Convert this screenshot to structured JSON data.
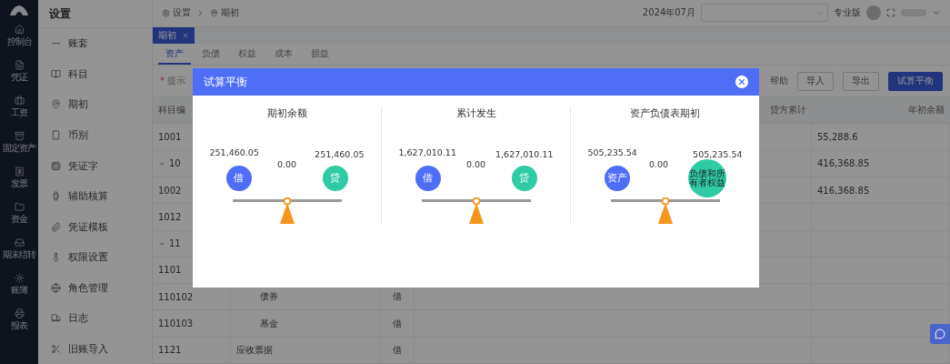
{
  "nav": {
    "items": [
      {
        "label": "控制台"
      },
      {
        "label": "凭证"
      },
      {
        "label": "工资"
      },
      {
        "label": "固定资产"
      },
      {
        "label": "发票"
      },
      {
        "label": "资金"
      },
      {
        "label": "期末结转"
      },
      {
        "label": "账簿"
      },
      {
        "label": "报表"
      }
    ]
  },
  "settings_menu": {
    "title": "设置",
    "items": [
      {
        "label": "账套"
      },
      {
        "label": "科目"
      },
      {
        "label": "期初"
      },
      {
        "label": "币别"
      },
      {
        "label": "凭证字"
      },
      {
        "label": "辅助核算"
      },
      {
        "label": "凭证模板"
      },
      {
        "label": "权限设置"
      },
      {
        "label": "角色管理"
      },
      {
        "label": "日志"
      },
      {
        "label": "旧账导入"
      }
    ]
  },
  "breadcrumb": [
    "设置",
    "期初"
  ],
  "header": {
    "period": "2024年07月",
    "edition": "专业版"
  },
  "page_tabs": [
    {
      "label": "期初",
      "selected": true
    }
  ],
  "category_tabs": [
    {
      "label": "资产",
      "selected": true
    },
    {
      "label": "负债",
      "selected": false
    },
    {
      "label": "权益",
      "selected": false
    },
    {
      "label": "成本",
      "selected": false
    },
    {
      "label": "损益",
      "selected": false
    }
  ],
  "toolbar": {
    "hint_mark": "*",
    "hint": "提示",
    "help": "帮助",
    "buttons": [
      {
        "label": "导入",
        "kind": "default"
      },
      {
        "label": "导出",
        "kind": "default"
      },
      {
        "label": "试算平衡",
        "kind": "primary"
      }
    ]
  },
  "table": {
    "columns": [
      "科目编",
      "贷方累计",
      "年初余额"
    ],
    "rows": [
      {
        "code": "1001",
        "opening": "55,288.6"
      },
      {
        "code": "10",
        "expanded": true,
        "opening": "416,368.85"
      },
      {
        "code": "1002",
        "opening": "416,368.85"
      },
      {
        "code": "1012"
      },
      {
        "code": "11",
        "expanded": true
      },
      {
        "code": "1101"
      },
      {
        "code": "110102",
        "name": "债券",
        "direction": "借"
      },
      {
        "code": "110103",
        "name": "基金",
        "direction": "借"
      },
      {
        "code": "1121",
        "name": "应收票据",
        "direction": "借"
      }
    ]
  },
  "dialog": {
    "title": "试算平衡",
    "panels": [
      {
        "title": "期初余额",
        "left_value": "251,460.05",
        "right_value": "251,460.05",
        "difference": "0.00",
        "left_label": "借",
        "right_label": "贷"
      },
      {
        "title": "累计发生",
        "left_value": "1,627,010.11",
        "right_value": "1,627,010.11",
        "difference": "0.00",
        "left_label": "借",
        "right_label": "贷"
      },
      {
        "title": "资产负债表期初",
        "left_value": "505,235.54",
        "right_value": "505,235.54",
        "difference": "0.00",
        "left_label": "资产",
        "right_label": "负债和所有者权益"
      }
    ]
  }
}
